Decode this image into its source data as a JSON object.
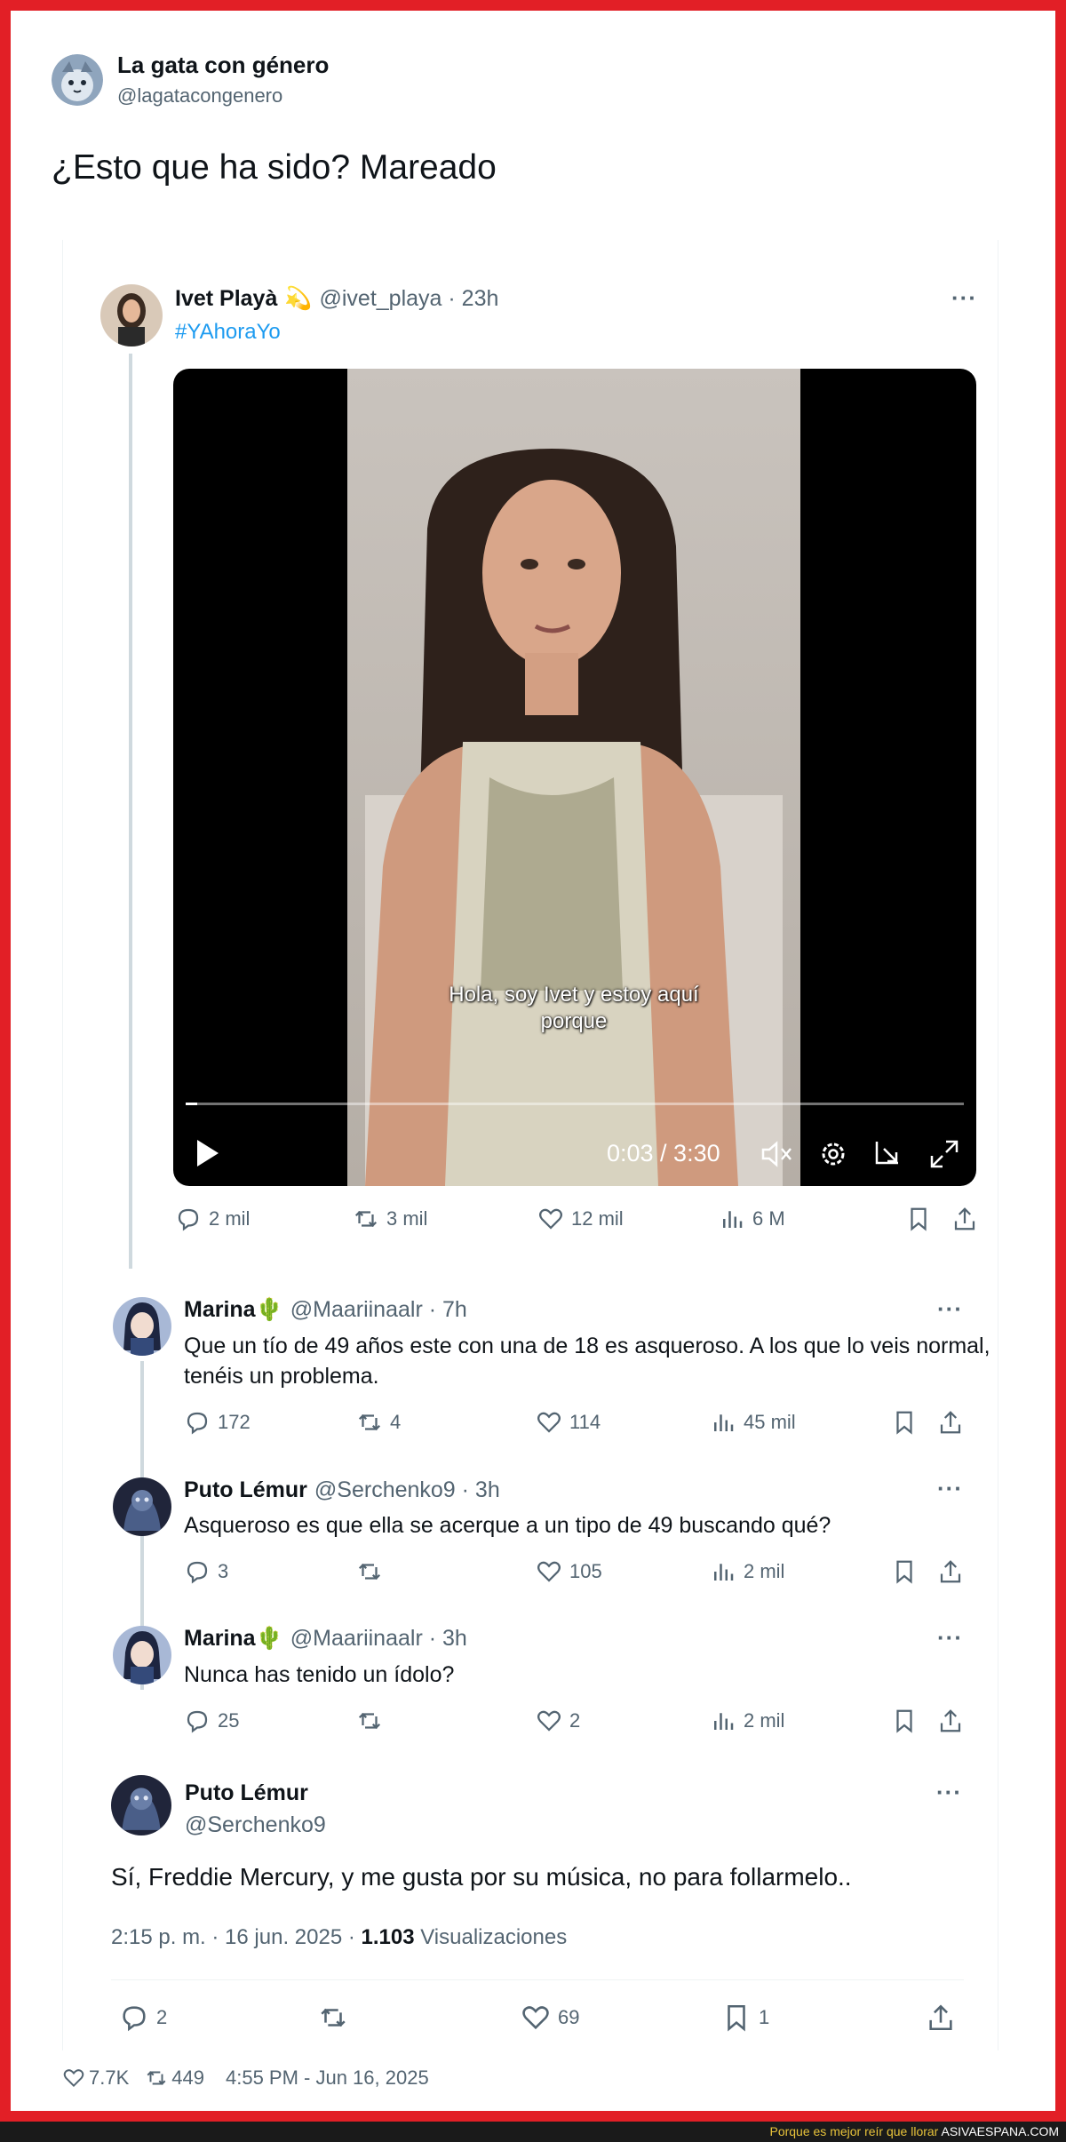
{
  "main_tweet": {
    "author_name": "La gata con género",
    "author_handle": "@lagatacongenero",
    "text": "¿Esto que ha sido? Mareado",
    "likes": "7.7K",
    "retweets": "449",
    "timestamp": "4:55 PM - Jun 16, 2025"
  },
  "quoted_tweet": {
    "author_name": "Ivet Playà",
    "author_emoji": "💫",
    "handle_time": "@ivet_playa · 23h",
    "hashtag": "#YAhoraYo",
    "video": {
      "subtitle_line1": "Hola, soy Ivet y estoy aquí",
      "subtitle_line2": "porque",
      "time": "0:03 / 3:30",
      "progress": 0.015
    },
    "stats": {
      "replies": "2 mil",
      "retweets": "3 mil",
      "likes": "12 mil",
      "views": "6 M"
    }
  },
  "replies": [
    {
      "name": "Marina",
      "emoji": "🌵",
      "handle_time": "@Maariinaalr · 7h",
      "text": "Que un tío de 49 años este con una de 18 es asqueroso. A los que lo veis normal, tenéis un problema.",
      "stats": {
        "replies": "172",
        "retweets": "4",
        "likes": "114",
        "views": "45 mil"
      }
    },
    {
      "name": "Puto Lémur",
      "emoji": "",
      "handle_time": "@Serchenko9 · 3h",
      "text": "Asqueroso es que ella se acerque a un tipo de 49 buscando qué?",
      "stats": {
        "replies": "3",
        "retweets": "",
        "likes": "105",
        "views": "2 mil"
      }
    },
    {
      "name": "Marina",
      "emoji": "🌵",
      "handle_time": "@Maariinaalr · 3h",
      "text": "Nunca has tenido un ídolo?",
      "stats": {
        "replies": "25",
        "retweets": "",
        "likes": "2",
        "views": "2 mil"
      }
    }
  ],
  "focus_reply": {
    "name": "Puto Lémur",
    "handle": "@Serchenko9",
    "text": "Sí, Freddie Mercury, y me gusta por su música, no para follarmelo..",
    "meta_prefix": "2:15 p. m. · 16 jun. 2025 · ",
    "views_count": "1.103",
    "views_label": " Visualizaciones",
    "stats": {
      "replies": "2",
      "retweets": "",
      "likes": "69",
      "bookmarks": "1"
    }
  },
  "footer": {
    "tagline": "Porque es mejor reír que llorar",
    "site": "ASIVAESPANA.COM"
  },
  "colors": {
    "frame": "#e21f26",
    "link": "#1d9bf0",
    "muted": "#536471"
  }
}
